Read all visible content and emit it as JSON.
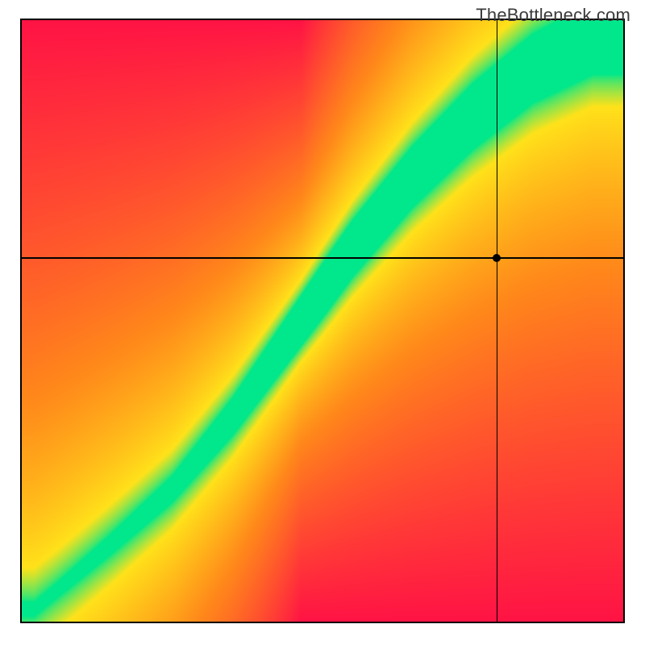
{
  "watermark": "TheBottleneck.com",
  "colors": {
    "red": "#ff1445",
    "orange": "#ff8a1a",
    "yellow": "#ffe21a",
    "green": "#00e88b"
  },
  "crosshair": {
    "x_frac": 0.79,
    "y_frac": 0.395
  },
  "chart_data": {
    "type": "heatmap",
    "title": "",
    "xlabel": "",
    "ylabel": "",
    "xlim": [
      0,
      100
    ],
    "ylim": [
      0,
      100
    ],
    "description": "Bottleneck heatmap: diagonal curved green band is optimal; deviation toward corners grades yellow→orange→red.",
    "optimal_band": {
      "comment": "Green band center expressed as y_frac (from top) at sampled x_frac values, estimated from image.",
      "samples": [
        {
          "x_frac": 0.02,
          "y_frac": 0.98
        },
        {
          "x_frac": 0.08,
          "y_frac": 0.93
        },
        {
          "x_frac": 0.15,
          "y_frac": 0.87
        },
        {
          "x_frac": 0.25,
          "y_frac": 0.78
        },
        {
          "x_frac": 0.35,
          "y_frac": 0.66
        },
        {
          "x_frac": 0.45,
          "y_frac": 0.52
        },
        {
          "x_frac": 0.55,
          "y_frac": 0.38
        },
        {
          "x_frac": 0.65,
          "y_frac": 0.26
        },
        {
          "x_frac": 0.75,
          "y_frac": 0.16
        },
        {
          "x_frac": 0.85,
          "y_frac": 0.08
        },
        {
          "x_frac": 0.95,
          "y_frac": 0.03
        }
      ],
      "half_width_frac_at": [
        {
          "x_frac": 0.05,
          "half": 0.012
        },
        {
          "x_frac": 0.25,
          "half": 0.022
        },
        {
          "x_frac": 0.5,
          "half": 0.045
        },
        {
          "x_frac": 0.75,
          "half": 0.055
        },
        {
          "x_frac": 0.95,
          "half": 0.06
        }
      ]
    },
    "marker": {
      "x_frac": 0.79,
      "y_frac": 0.395,
      "color_zone": "yellow-orange"
    }
  }
}
